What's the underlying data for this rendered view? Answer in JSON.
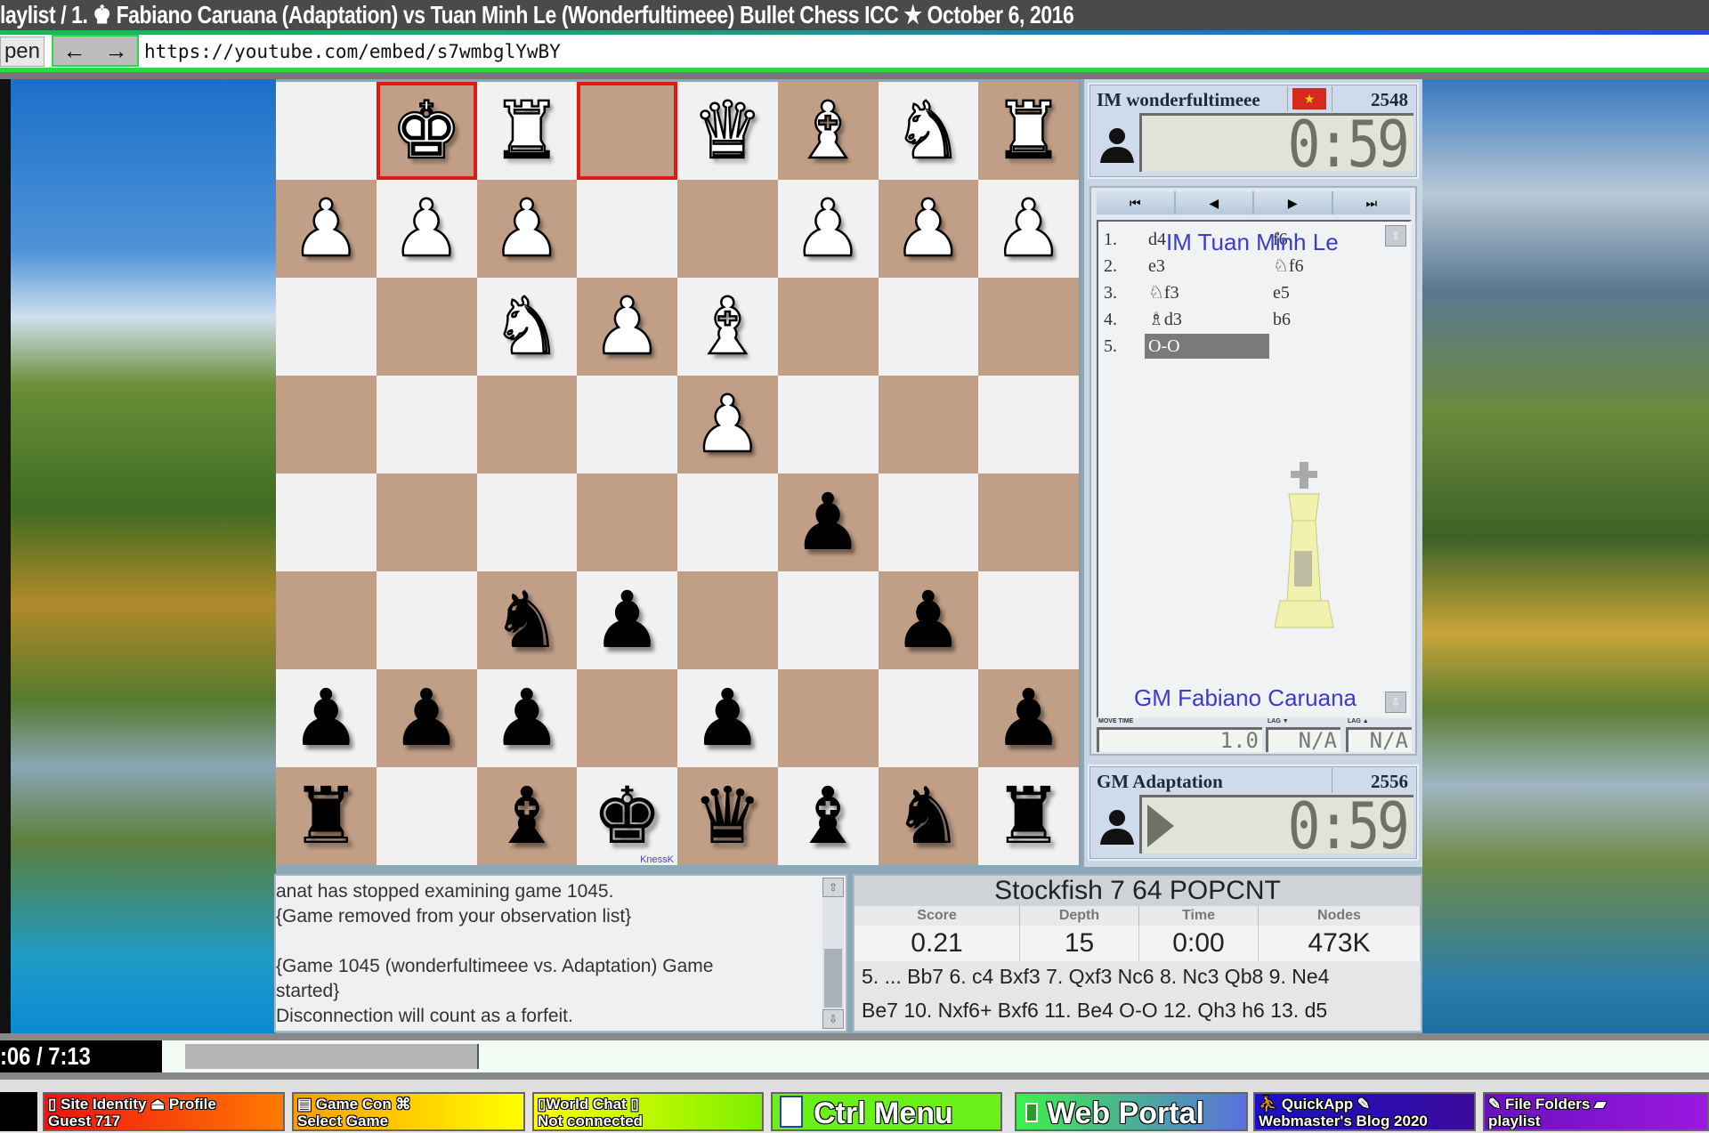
{
  "window": {
    "title": "laylist / 1. ♚ Fabiano Caruana (Adaptation) vs Tuan Minh Le (Wonderfultimeee) Bullet Chess ICC ★ October 6, 2016"
  },
  "url_bar": {
    "open_label": "pen",
    "back_icon": "←",
    "forward_icon": "→",
    "url": "https://youtube.com/embed/s7wmbglYwBY"
  },
  "board": {
    "orientation": "black-bottom",
    "highlight_squares": [
      "g1",
      "e1"
    ],
    "ranks": [
      [
        "",
        "♚w",
        "♜w",
        "",
        "♛w",
        "♝w",
        "♞w",
        "♜w"
      ],
      [
        "♟w",
        "♟w",
        "♟w",
        "",
        "",
        "♟w",
        "♟w",
        "♟w"
      ],
      [
        "",
        "",
        "♞w",
        "♟w",
        "♝w",
        "",
        "",
        ""
      ],
      [
        "",
        "",
        "",
        "",
        "♟w",
        "",
        "",
        ""
      ],
      [
        "",
        "",
        "",
        "",
        "",
        "♟b",
        "",
        ""
      ],
      [
        "",
        "",
        "♞b",
        "♟b",
        "",
        "",
        "♟b",
        ""
      ],
      [
        "♟b",
        "♟b",
        "♟b",
        "",
        "♟b",
        "",
        "",
        "♟b"
      ],
      [
        "♜b",
        "",
        "♝b",
        "♚b",
        "♛b",
        "♝b",
        "♞b",
        "♜b"
      ]
    ],
    "watermark": "KnessK"
  },
  "top_player": {
    "title_name": "IM wonderfultimeee",
    "flag": "vietnam-flag",
    "rating": "2548",
    "clock": "0:59"
  },
  "bottom_player": {
    "title_name": "GM Adaptation",
    "rating": "2556",
    "clock": "0:59",
    "to_move": true
  },
  "move_nav": {
    "first": "⏮",
    "prev": "◀",
    "next": "▶",
    "last": "⏭"
  },
  "moves": [
    {
      "num": "1.",
      "white": "d4",
      "black": "f6"
    },
    {
      "num": "2.",
      "white": "e3",
      "black": "♘f6"
    },
    {
      "num": "3.",
      "white": "♘f3",
      "black": "e5"
    },
    {
      "num": "4.",
      "white": "♗d3",
      "black": "b6"
    },
    {
      "num": "5.",
      "white": "O-O",
      "black": ""
    }
  ],
  "current_move_index": 4,
  "overlay_names": {
    "top": "IM Tuan Minh Le",
    "bottom": "GM Fabiano Caruana"
  },
  "timers": {
    "move_time_label": "MOVE TIME",
    "move_time": "1.0",
    "lag_down_label": "LAG ▼",
    "lag_down": "N/A",
    "lag_up_label": "LAG ▲",
    "lag_up": "N/A"
  },
  "console": {
    "lines": [
      "anat has stopped examining game 1045.",
      "{Game removed from your observation list}",
      "",
      "{Game 1045 (wonderfultimeee vs. Adaptation) Game",
      "started}",
      "Disconnection will count as a forfeit."
    ]
  },
  "engine": {
    "name": "Stockfish 7 64 POPCNT",
    "headers": [
      "Score",
      "Depth",
      "Time",
      "Nodes"
    ],
    "score": "0.21",
    "depth": "15",
    "time": "0:00",
    "nodes": "473K",
    "pv_lines": [
      "5. ... Bb7 6. c4 Bxf3 7. Qxf3 Nc6 8. Nc3 Qb8 9. Ne4",
      "Be7 10. Nxf6+ Bxf6 11. Be4 O-O 12. Qh3 h6 13. d5"
    ]
  },
  "player_bar": {
    "timecode": ":06 / 7:13",
    "progress_fraction": 0.19
  },
  "taskbar": {
    "items": [
      {
        "line1": "▯ Site Identity ⏏ Profile",
        "line2": "Guest 717"
      },
      {
        "line1": "▤ Game Con ⌘",
        "line2": "Select Game"
      },
      {
        "line1": "▯World Chat ▯",
        "line2": "Not connected"
      },
      {
        "line1": "Ctrl  Menu",
        "line2": ""
      },
      {
        "line1": "Web Portal",
        "line2": ""
      },
      {
        "line1": "⛹ QuickApp ✎",
        "line2": "Webmaster's Blog 2020"
      },
      {
        "line1": "✎ File Folders ▰",
        "line2": "playlist"
      }
    ]
  }
}
